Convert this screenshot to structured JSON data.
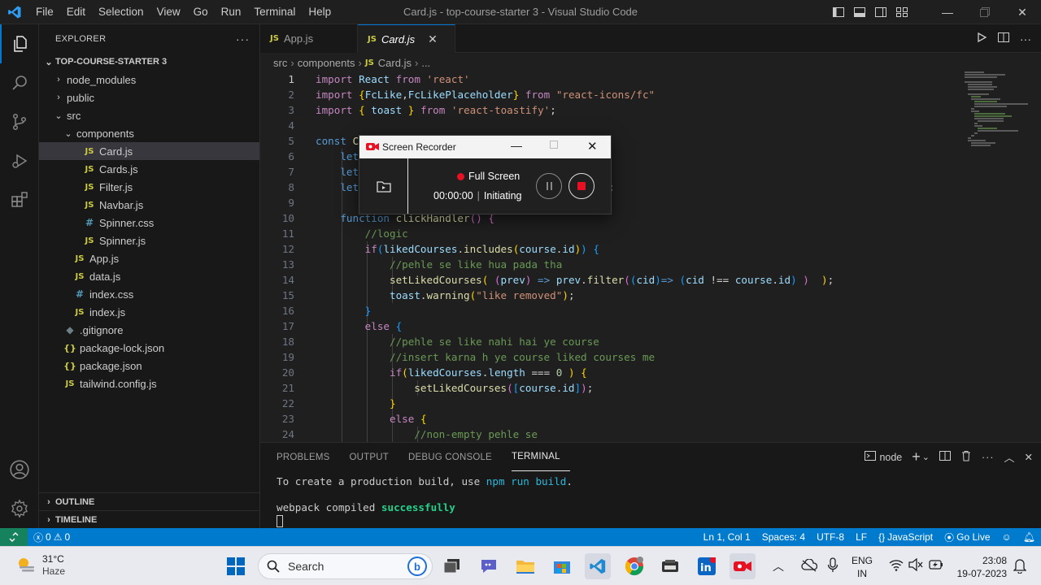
{
  "window": {
    "title": "Card.js - top-course-starter 3 - Visual Studio Code",
    "menu": [
      "File",
      "Edit",
      "Selection",
      "View",
      "Go",
      "Run",
      "Terminal",
      "Help"
    ]
  },
  "explorer": {
    "header": "EXPLORER",
    "more": "···",
    "project": "TOP-COURSE-STARTER 3",
    "tree": [
      {
        "label": "node_modules",
        "type": "folder",
        "depth": 1,
        "expanded": false
      },
      {
        "label": "public",
        "type": "folder",
        "depth": 1,
        "expanded": false
      },
      {
        "label": "src",
        "type": "folder",
        "depth": 1,
        "expanded": true
      },
      {
        "label": "components",
        "type": "folder",
        "depth": 2,
        "expanded": true
      },
      {
        "label": "Card.js",
        "type": "js",
        "depth": 3,
        "selected": true
      },
      {
        "label": "Cards.js",
        "type": "js",
        "depth": 3
      },
      {
        "label": "Filter.js",
        "type": "js",
        "depth": 3
      },
      {
        "label": "Navbar.js",
        "type": "js",
        "depth": 3
      },
      {
        "label": "Spinner.css",
        "type": "css",
        "depth": 3
      },
      {
        "label": "Spinner.js",
        "type": "js",
        "depth": 3
      },
      {
        "label": "App.js",
        "type": "js",
        "depth": 2
      },
      {
        "label": "data.js",
        "type": "js",
        "depth": 2
      },
      {
        "label": "index.css",
        "type": "css",
        "depth": 2
      },
      {
        "label": "index.js",
        "type": "js",
        "depth": 2
      },
      {
        "label": ".gitignore",
        "type": "git",
        "depth": 1
      },
      {
        "label": "package-lock.json",
        "type": "json",
        "depth": 1
      },
      {
        "label": "package.json",
        "type": "json",
        "depth": 1
      },
      {
        "label": "tailwind.config.js",
        "type": "js",
        "depth": 1
      }
    ],
    "outline": "OUTLINE",
    "timeline": "TIMELINE"
  },
  "tabs": [
    {
      "label": "App.js",
      "active": false
    },
    {
      "label": "Card.js",
      "active": true,
      "close": "✕"
    }
  ],
  "breadcrumb": [
    "src",
    "components",
    "Card.js",
    "..."
  ],
  "editor": {
    "lines": [
      {
        "n": "1",
        "html": "<span class='kw'>import</span> <span class='vr'>React</span> <span class='kw'>from</span> <span class='st'>'react'</span>"
      },
      {
        "n": "2",
        "html": "<span class='kw'>import</span> <span class='br1'>{</span><span class='vr'>FcLike</span>,<span class='vr'>FcLikePlaceholder</span><span class='br1'>}</span> <span class='kw'>from</span> <span class='st'>\"react-icons/fc\"</span>"
      },
      {
        "n": "3",
        "html": "<span class='kw'>import</span> <span class='br1'>{</span> <span class='vr'>toast</span> <span class='br1'>}</span> <span class='kw'>from</span> <span class='st'>'react-toastify'</span>;"
      },
      {
        "n": "4",
        "html": ""
      },
      {
        "n": "5",
        "html": "<span class='kb'>const</span> <span class='fn'>C</span>"
      },
      {
        "n": "6",
        "html": "    <span class='kb'>let</span>"
      },
      {
        "n": "7",
        "html": "    <span class='kb'>let</span>"
      },
      {
        "n": "8",
        "html": "    <span class='kb'>let</span>"
      },
      {
        "n": "9",
        "html": ""
      },
      {
        "n": "10",
        "html": "    <span class='kb'>function</span> <span class='fn'>clickHandler</span><span class='br2'>()</span> <span class='br2'>{</span>"
      },
      {
        "n": "11",
        "html": "        <span class='cm'>//logic</span>"
      },
      {
        "n": "12",
        "html": "        <span class='kw'>if</span><span class='br3'>(</span><span class='vr'>likedCourses</span>.<span class='fn'>includes</span><span class='br1'>(</span><span class='vr'>course</span>.<span class='vr'>id</span><span class='br1'>)</span><span class='br3'>)</span> <span class='br3'>{</span>"
      },
      {
        "n": "13",
        "html": "            <span class='cm'>//pehle se like hua pada tha</span>"
      },
      {
        "n": "14",
        "html": "            <span class='fn'>setLikedCourses</span><span class='br1'>(</span> <span class='br2'>(</span><span class='vr'>prev</span><span class='br2'>)</span> <span class='kb'>=&gt;</span> <span class='vr'>prev</span>.<span class='fn'>filter</span><span class='br2'>(</span><span class='br3'>(</span><span class='vr'>cid</span><span class='br3'>)</span><span class='kb'>=&gt;</span> <span class='br3'>(</span><span class='vr'>cid</span> !== <span class='vr'>course</span>.<span class='vr'>id</span><span class='br3'>)</span> <span class='br2'>)</span>  <span class='br1'>)</span>;"
      },
      {
        "n": "15",
        "html": "            <span class='vr'>toast</span>.<span class='fn'>warning</span><span class='br1'>(</span><span class='st'>\"like removed\"</span><span class='br1'>)</span>;"
      },
      {
        "n": "16",
        "html": "        <span class='br3'>}</span>"
      },
      {
        "n": "17",
        "html": "        <span class='kw'>else</span> <span class='br3'>{</span>"
      },
      {
        "n": "18",
        "html": "            <span class='cm'>//pehle se like nahi hai ye course</span>"
      },
      {
        "n": "19",
        "html": "            <span class='cm'>//insert karna h ye course liked courses me</span>"
      },
      {
        "n": "20",
        "html": "            <span class='kw'>if</span><span class='br1'>(</span><span class='vr'>likedCourses</span>.<span class='vr'>length</span> === <span class='nm'>0</span> <span class='br1'>)</span> <span class='br1'>{</span>"
      },
      {
        "n": "21",
        "html": "                <span class='fn'>setLikedCourses</span><span class='br2'>(</span><span class='br3'>[</span><span class='vr'>course</span>.<span class='vr'>id</span><span class='br3'>]</span><span class='br2'>)</span>;"
      },
      {
        "n": "22",
        "html": "            <span class='br1'>}</span>"
      },
      {
        "n": "23",
        "html": "            <span class='kw'>else</span> <span class='br1'>{</span>"
      },
      {
        "n": "24",
        "html": "                <span class='cm'>//non-empty pehle se</span>"
      }
    ],
    "hidden_suffix": ";"
  },
  "panel": {
    "tabs": [
      "PROBLEMS",
      "OUTPUT",
      "DEBUG CONSOLE",
      "TERMINAL"
    ],
    "active_tab": "TERMINAL",
    "shell": "node",
    "terminal": {
      "line1_prefix": "To create a production build, use ",
      "line1_cmd": "npm run build",
      "line1_suffix": ".",
      "line2_prefix": "webpack compiled ",
      "line2_status": "successfully"
    }
  },
  "statusbar": {
    "errors": "0",
    "warnings": "0",
    "position": "Ln 1, Col 1",
    "spaces": "Spaces: 4",
    "encoding": "UTF-8",
    "eol": "LF",
    "language": "JavaScript",
    "golive": "Go Live"
  },
  "recorder": {
    "title": "Screen Recorder",
    "mode": "Full Screen",
    "time": "00:00:00",
    "status": "Initiating",
    "record_color": "#e81123"
  },
  "taskbar": {
    "weather_temp": "31°C",
    "weather_desc": "Haze",
    "search_placeholder": "Search",
    "lang1": "ENG",
    "lang2": "IN",
    "time": "23:08",
    "date": "19-07-2023"
  },
  "colors": {
    "accent": "#007acc",
    "js_icon": "#cbcb41"
  }
}
